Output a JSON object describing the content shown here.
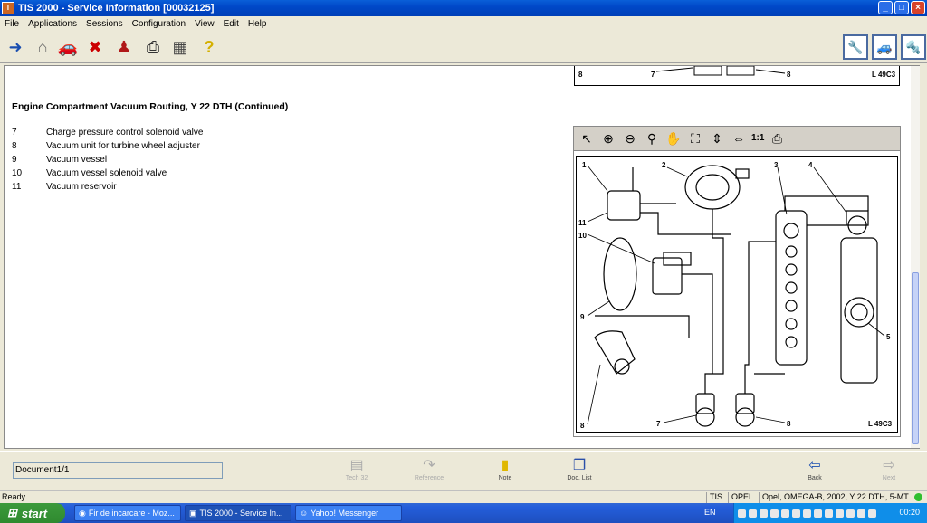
{
  "window": {
    "title": "TIS 2000 - Service Information [00032125]"
  },
  "menu": [
    "File",
    "Applications",
    "Sessions",
    "Configuration",
    "View",
    "Edit",
    "Help"
  ],
  "document": {
    "title": "Engine Compartment Vacuum Routing, Y 22 DTH (Continued)",
    "legend": [
      {
        "num": "7",
        "text": "Charge pressure control solenoid valve"
      },
      {
        "num": "8",
        "text": "Vacuum unit for turbine wheel adjuster"
      },
      {
        "num": "9",
        "text": "Vacuum vessel"
      },
      {
        "num": "10",
        "text": "Vacuum vessel solenoid valve"
      },
      {
        "num": "11",
        "text": "Vacuum reservoir"
      }
    ]
  },
  "viewer": {
    "ratio_label": "1:1",
    "diagram_ref": "L 49C3",
    "top_ref": "L 49C3"
  },
  "diagram_labels": {
    "l1": "1",
    "l2": "2",
    "l3": "3",
    "l4": "4",
    "l5": "5",
    "l7": "7",
    "l8": "8",
    "l9": "9",
    "l10": "10",
    "l11": "11"
  },
  "bottom": {
    "document_field": "Document1/1",
    "buttons": [
      {
        "label": "Tech 32",
        "enabled": false
      },
      {
        "label": "Reference",
        "enabled": false
      },
      {
        "label": "Note",
        "enabled": true
      },
      {
        "label": "Doc. List",
        "enabled": true
      },
      {
        "label": "Back",
        "enabled": true
      },
      {
        "label": "Next",
        "enabled": false
      }
    ]
  },
  "status": {
    "ready": "Ready",
    "app": "TIS",
    "make": "OPEL",
    "vehicle": "Opel, OMEGA-B, 2002, Y 22 DTH, 5-MT"
  },
  "taskbar": {
    "start": "start",
    "tasks": [
      "Fir de incarcare - Moz...",
      "TIS 2000 - Service In...",
      "Yahoo! Messenger"
    ],
    "lang": "EN",
    "clock": "00:20"
  }
}
